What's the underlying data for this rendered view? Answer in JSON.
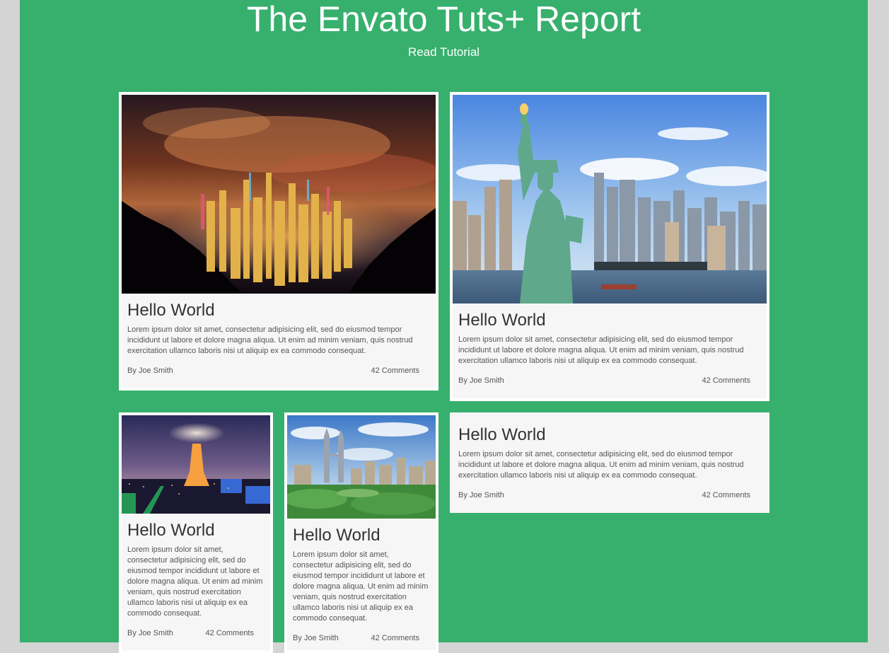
{
  "header": {
    "title": "The Envato Tuts+ Report",
    "link_label": "Read Tutorial"
  },
  "colors": {
    "page_bg": "#d4d4d4",
    "accent_green": "#37b06d",
    "card_bg": "#f7f6f7",
    "card_border": "#ffffff"
  },
  "cards": [
    {
      "image": "hong-kong-night-skyline-photo",
      "title": "Hello World",
      "excerpt": "Lorem ipsum dolor sit amet, consectetur adipisicing elit, sed do eiusmod tempor incididunt ut labore et dolore magna aliqua. Ut enim ad minim veniam, quis nostrud exercitation ullamco laboris nisi ut aliquip ex ea commodo consequat.",
      "author": "By Joe Smith",
      "comments": "42 Comments"
    },
    {
      "image": "statue-of-liberty-new-york-photo",
      "title": "Hello World",
      "excerpt": "Lorem ipsum dolor sit amet, consectetur adipisicing elit, sed do eiusmod tempor incididunt ut labore et dolore magna aliqua. Ut enim ad minim veniam, quis nostrud exercitation ullamco laboris nisi ut aliquip ex ea commodo consequat.",
      "author": "By Joe Smith",
      "comments": "42 Comments"
    },
    {
      "image": "paris-eiffel-tower-night-photo",
      "title": "Hello World",
      "excerpt": "Lorem ipsum dolor sit amet, consectetur adipisicing elit, sed do eiusmod tempor incididunt ut labore et dolore magna aliqua. Ut enim ad minim veniam, quis nostrud exercitation ullamco laboris nisi ut aliquip ex ea commodo consequat.",
      "author": "By Joe Smith",
      "comments": "42 Comments"
    },
    {
      "image": "kuala-lumpur-petronas-towers-photo",
      "title": "Hello World",
      "excerpt": "Lorem ipsum dolor sit amet, consectetur adipisicing elit, sed do eiusmod tempor incididunt ut labore et dolore magna aliqua. Ut enim ad minim veniam, quis nostrud exercitation ullamco laboris nisi ut aliquip ex ea commodo consequat.",
      "author": "By Joe Smith",
      "comments": "42 Comments"
    },
    {
      "title": "Hello World",
      "excerpt": "Lorem ipsum dolor sit amet, consectetur adipisicing elit, sed do eiusmod tempor incididunt ut labore et dolore magna aliqua. Ut enim ad minim veniam, quis nostrud exercitation ullamco laboris nisi ut aliquip ex ea commodo consequat.",
      "author": "By Joe Smith",
      "comments": "42 Comments"
    }
  ]
}
